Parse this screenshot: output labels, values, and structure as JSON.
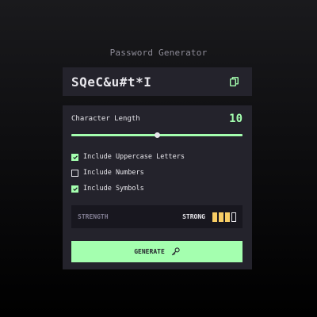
{
  "app": {
    "title": "Password Generator"
  },
  "password": {
    "value": "SQeC&u#t*I",
    "copy_icon": "copy-icon"
  },
  "length": {
    "label": "Character Length",
    "value": "10",
    "min": 0,
    "max": 20,
    "current": 10
  },
  "options": [
    {
      "label": "Include Uppercase Letters",
      "checked": true
    },
    {
      "label": "Include Numbers",
      "checked": false
    },
    {
      "label": "Include Symbols",
      "checked": true
    }
  ],
  "strength": {
    "label": "STRENGTH",
    "value": "STRONG",
    "level": 3,
    "max_level": 4,
    "color": "#f8cd65"
  },
  "generate": {
    "label": "GENERATE",
    "icon": "arrow-right-icon"
  },
  "colors": {
    "accent": "#a4ffaf",
    "panel": "#24232c",
    "strength_box": "#18171f",
    "text": "#e6e5ea"
  }
}
